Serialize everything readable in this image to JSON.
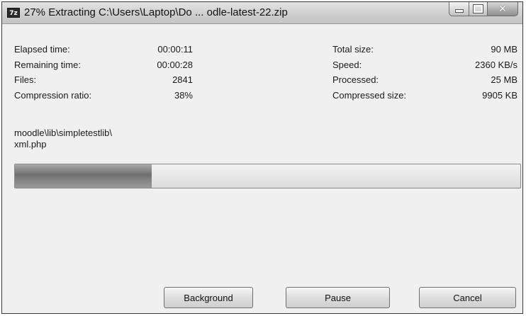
{
  "window": {
    "title": "27% Extracting C:\\Users\\Laptop\\Do ... odle-latest-22.zip",
    "app_icon_text": "7z"
  },
  "stats_left": [
    {
      "label": "Elapsed time:",
      "value": "00:00:11"
    },
    {
      "label": "Remaining time:",
      "value": "00:00:28"
    },
    {
      "label": "Files:",
      "value": "2841"
    },
    {
      "label": "Compression ratio:",
      "value": "38%"
    }
  ],
  "stats_right": [
    {
      "label": "Total size:",
      "value": "90 MB"
    },
    {
      "label": "Speed:",
      "value": "2360 KB/s"
    },
    {
      "label": "Processed:",
      "value": "25 MB"
    },
    {
      "label": "Compressed size:",
      "value": "9905 KB"
    }
  ],
  "current_file": {
    "line1": "moodle\\lib\\simpletestlib\\",
    "line2": "xml.php"
  },
  "progress": {
    "percent": 27
  },
  "buttons": {
    "background": "Background",
    "pause": "Pause",
    "cancel": "Cancel"
  }
}
